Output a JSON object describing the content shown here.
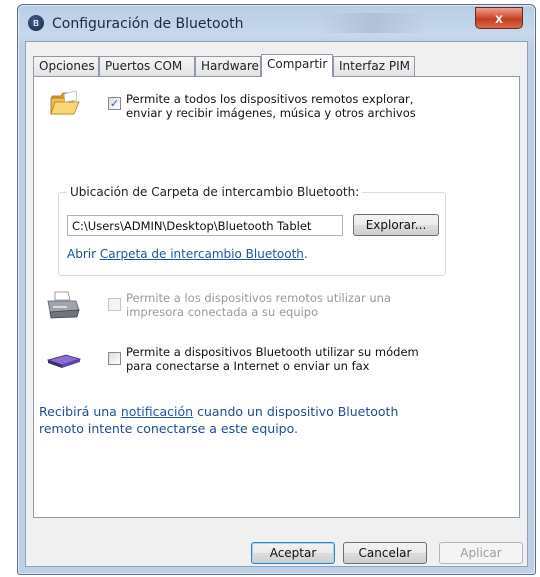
{
  "window": {
    "title": "Configuración de Bluetooth",
    "close_label": "x"
  },
  "tabs": [
    {
      "label": "Opciones"
    },
    {
      "label": "Puertos COM"
    },
    {
      "label": "Hardware"
    },
    {
      "label": "Compartir"
    },
    {
      "label": "Interfaz PIM"
    }
  ],
  "active_tab": "Compartir",
  "share": {
    "allow_remote_browse": {
      "checked": true,
      "line1": "Permite a todos los dispositivos remotos explorar,",
      "line2": "enviar y recibir imágenes, música y otros archivos"
    },
    "folder_group": {
      "legend": "Ubicación de Carpeta de intercambio Bluetooth:",
      "path": "C:\\Users\\ADMIN\\Desktop\\Bluetooth Tablet",
      "browse_label": "Explorar...",
      "open_prefix": "Abrir ",
      "open_link": "Carpeta de intercambio Bluetooth",
      "open_suffix": "."
    },
    "printer": {
      "checked": false,
      "enabled": false,
      "line1": "Permite a los dispositivos remotos utilizar una",
      "line2": "impresora conectada a su equipo"
    },
    "modem": {
      "checked": false,
      "line1": "Permite a dispositivos Bluetooth utilizar su módem",
      "line2": "para conectarse a Internet o enviar un fax"
    },
    "notification": {
      "prefix": "Recibirá una ",
      "link": "notificación",
      "suffix1": " cuando un dispositivo Bluetooth",
      "line2": "remoto intente conectarse a este equipo."
    }
  },
  "buttons": {
    "ok": "Aceptar",
    "cancel": "Cancelar",
    "apply": "Aplicar"
  },
  "icons": {
    "title": "bluetooth-icon",
    "folder": "folder-icon",
    "printer": "printer-icon",
    "modem": "modem-icon"
  }
}
